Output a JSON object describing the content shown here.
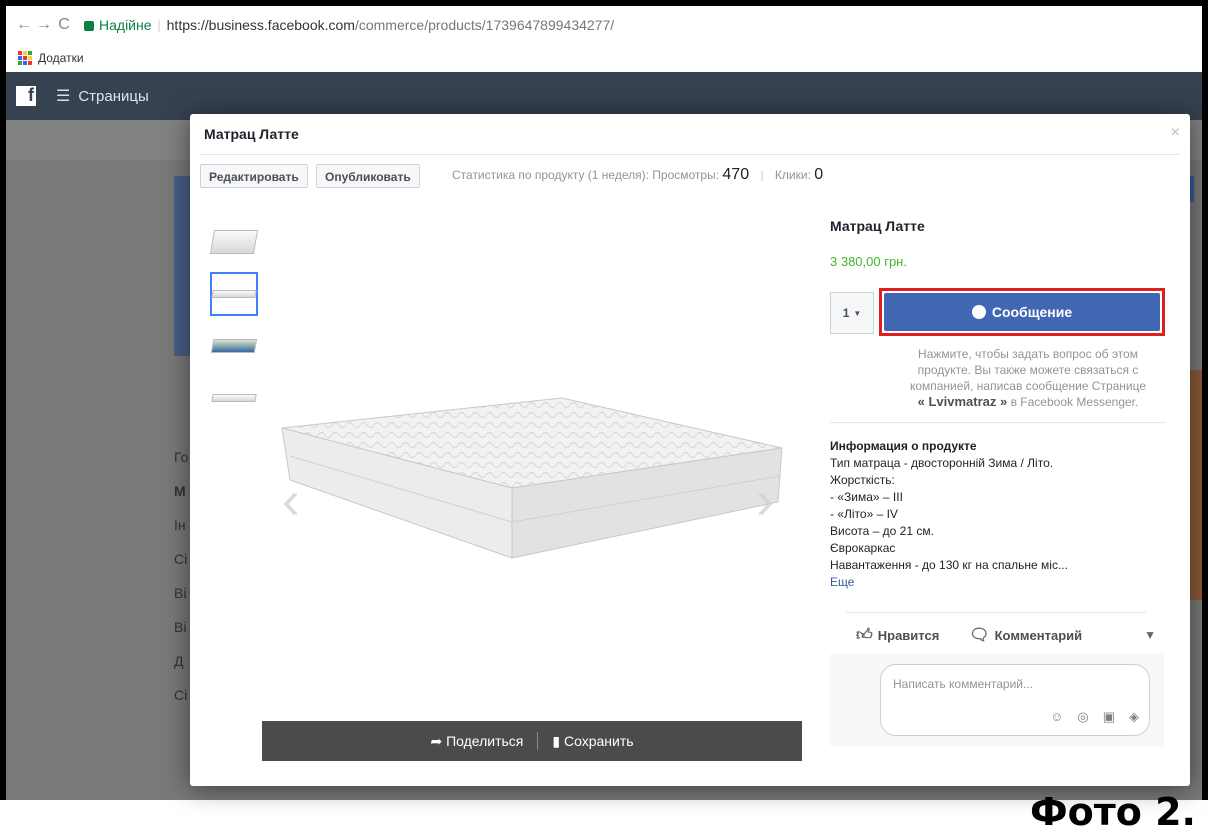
{
  "browser": {
    "back_icon": "back-arrow",
    "forward_icon": "forward-arrow",
    "reload_icon": "reload",
    "secure_label": "Надійне",
    "url_host": "https://business.facebook.com",
    "url_path": "/commerce/products/1739647899434277/",
    "bookmarks_label": "Додатки"
  },
  "fbbar": {
    "logo": "f",
    "pages_label": "Страницы"
  },
  "background": {
    "side_items": [
      "Го",
      "М",
      "Ін",
      "Сі",
      "Ві",
      "Ві",
      "Д",
      "Сі"
    ]
  },
  "modal": {
    "title": "Матрац Латте",
    "close": "×",
    "edit_label": "Редактировать",
    "publish_label": "Опубликовать",
    "stats_label": "Статистика по продукту (1 неделя):",
    "views_label": "Просмотры:",
    "views_value": "470",
    "clicks_label": "Клики:",
    "clicks_value": "0"
  },
  "gallery": {
    "prev": "‹",
    "next": "›",
    "share_label": "Поделиться",
    "save_label": "Сохранить"
  },
  "product": {
    "title": "Матрац Латте",
    "price": "3 380,00 грн.",
    "qty": "1",
    "message_label": "Сообщение",
    "help_text_1": "Нажмите, чтобы задать вопрос об этом продукте. Вы также можете связаться с компанией, написав сообщение Странице",
    "help_page": "« Lvivmatraz »",
    "help_text_2": "в Facebook Messenger.",
    "info_heading": "Информация о продукте",
    "info_lines": [
      "Тип матраца - двосторонній Зима / Літо.",
      "Жорсткість:",
      "- «Зима» – III",
      "- «Літо» – IV",
      "Висота – до 21 см.",
      "Єврокаркас",
      "Навантаження - до 130 кг на спальне міс..."
    ],
    "more_label": "Еще",
    "like_label": "Нравится",
    "comment_label": "Комментарий",
    "comment_placeholder": "Написать комментарий..."
  },
  "caption": "Фото 2."
}
